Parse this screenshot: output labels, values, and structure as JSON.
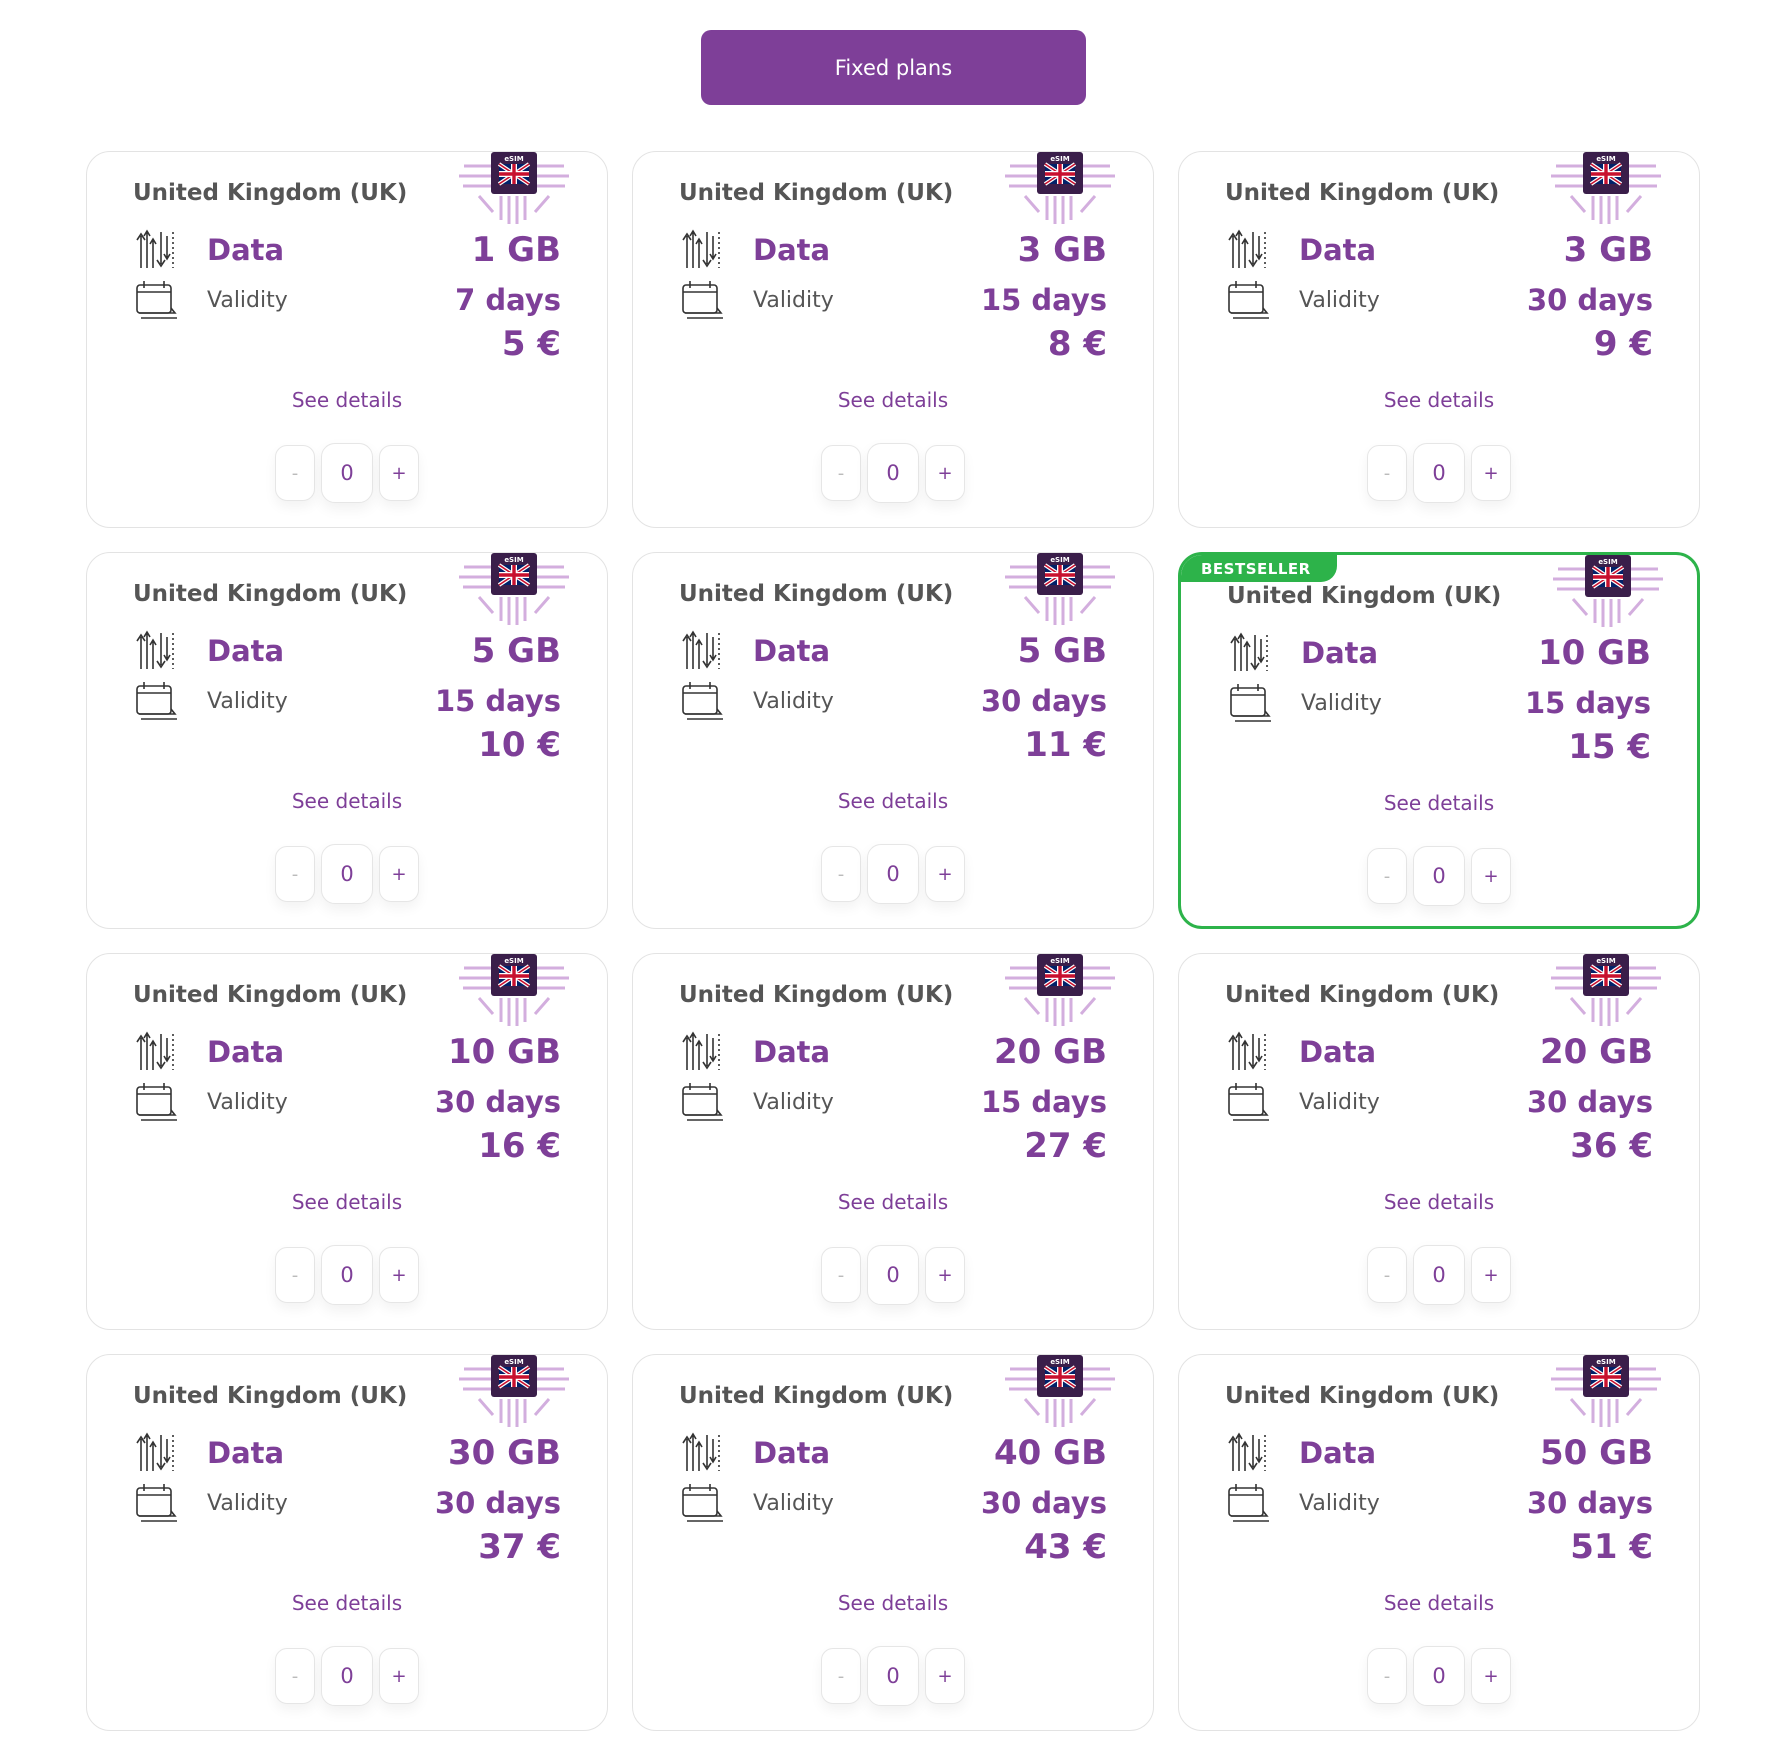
{
  "tabs": {
    "fixed_label": "Fixed plans"
  },
  "chip": {
    "esim_text": "eSIM",
    "flag": "uk-flag"
  },
  "colors": {
    "brand": "#7e3f98",
    "bestseller": "#2db34a"
  },
  "icons": {
    "data": "data-transfer-icon",
    "validity": "calendar-icon"
  },
  "labels": {
    "data": "Data",
    "validity": "Validity",
    "see_details": "See details"
  },
  "plans": [
    {
      "country": "United Kingdom (UK)",
      "data": "1 GB",
      "validity": "7 days",
      "price": "5 €",
      "qty": "0",
      "minus": "-",
      "plus": "+"
    },
    {
      "country": "United Kingdom (UK)",
      "data": "3 GB",
      "validity": "15 days",
      "price": "8 €",
      "qty": "0",
      "minus": "-",
      "plus": "+"
    },
    {
      "country": "United Kingdom (UK)",
      "data": "3 GB",
      "validity": "30 days",
      "price": "9 €",
      "qty": "0",
      "minus": "-",
      "plus": "+"
    },
    {
      "country": "United Kingdom (UK)",
      "data": "5 GB",
      "validity": "15 days",
      "price": "10 €",
      "qty": "0",
      "minus": "-",
      "plus": "+"
    },
    {
      "country": "United Kingdom (UK)",
      "data": "5 GB",
      "validity": "30 days",
      "price": "11 €",
      "qty": "0",
      "minus": "-",
      "plus": "+"
    },
    {
      "country": "United Kingdom (UK)",
      "data": "10 GB",
      "validity": "15 days",
      "price": "15 €",
      "qty": "0",
      "minus": "-",
      "plus": "+",
      "badge": "BESTSELLER"
    },
    {
      "country": "United Kingdom (UK)",
      "data": "10 GB",
      "validity": "30 days",
      "price": "16 €",
      "qty": "0",
      "minus": "-",
      "plus": "+"
    },
    {
      "country": "United Kingdom (UK)",
      "data": "20 GB",
      "validity": "15 days",
      "price": "27 €",
      "qty": "0",
      "minus": "-",
      "plus": "+"
    },
    {
      "country": "United Kingdom (UK)",
      "data": "20 GB",
      "validity": "30 days",
      "price": "36 €",
      "qty": "0",
      "minus": "-",
      "plus": "+"
    },
    {
      "country": "United Kingdom (UK)",
      "data": "30 GB",
      "validity": "30 days",
      "price": "37 €",
      "qty": "0",
      "minus": "-",
      "plus": "+"
    },
    {
      "country": "United Kingdom (UK)",
      "data": "40 GB",
      "validity": "30 days",
      "price": "43 €",
      "qty": "0",
      "minus": "-",
      "plus": "+"
    },
    {
      "country": "United Kingdom (UK)",
      "data": "50 GB",
      "validity": "30 days",
      "price": "51 €",
      "qty": "0",
      "minus": "-",
      "plus": "+"
    }
  ]
}
